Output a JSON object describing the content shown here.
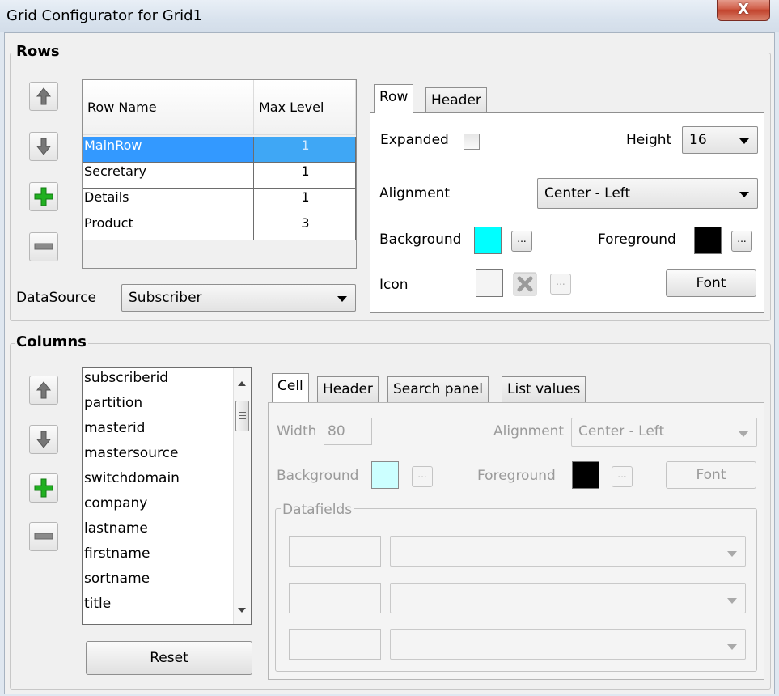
{
  "window": {
    "title": "Grid Configurator for Grid1",
    "close_label": "X"
  },
  "rows_group": {
    "legend": "Rows",
    "table": {
      "headers": [
        "Row Name",
        "Max Level"
      ],
      "rows": [
        {
          "name": "MainRow",
          "max_level": "1",
          "selected": true
        },
        {
          "name": "Secretary",
          "max_level": "1",
          "selected": false
        },
        {
          "name": "Details",
          "max_level": "1",
          "selected": false
        },
        {
          "name": "Product",
          "max_level": "3",
          "selected": false
        }
      ]
    },
    "datasource_label": "DataSource",
    "datasource_value": "Subscriber",
    "tabs": [
      "Row",
      "Header"
    ],
    "active_tab": "Row",
    "expanded_label": "Expanded",
    "expanded_checked": false,
    "height_label": "Height",
    "height_value": "16",
    "alignment_label": "Alignment",
    "alignment_value": "Center - Left",
    "background_label": "Background",
    "background_color": "#00ffff",
    "foreground_label": "Foreground",
    "foreground_color": "#000000",
    "icon_label": "Icon",
    "dots_label": "...",
    "font_label": "Font"
  },
  "columns_group": {
    "legend": "Columns",
    "list": [
      "subscriberid",
      "partition",
      "masterid",
      "mastersource",
      "switchdomain",
      "company",
      "lastname",
      "firstname",
      "sortname",
      "title"
    ],
    "reset_label": "Reset",
    "tabs": [
      "Cell",
      "Header",
      "Search panel",
      "List values"
    ],
    "active_tab": "Cell",
    "width_label": "Width",
    "width_value": "80",
    "alignment_label": "Alignment",
    "alignment_value": "Center - Left",
    "background_label": "Background",
    "background_color": "#ccffff",
    "foreground_label": "Foreground",
    "foreground_color": "#000000",
    "dots_label": "...",
    "font_label": "Font",
    "datafields_legend": "Datafields"
  },
  "icons": {
    "move_up": "arrow-up-icon",
    "move_down": "arrow-down-icon",
    "add": "plus-icon",
    "remove": "minus-icon",
    "clear_icon": "delete-x-icon",
    "accent_green": "#1fa21f"
  }
}
